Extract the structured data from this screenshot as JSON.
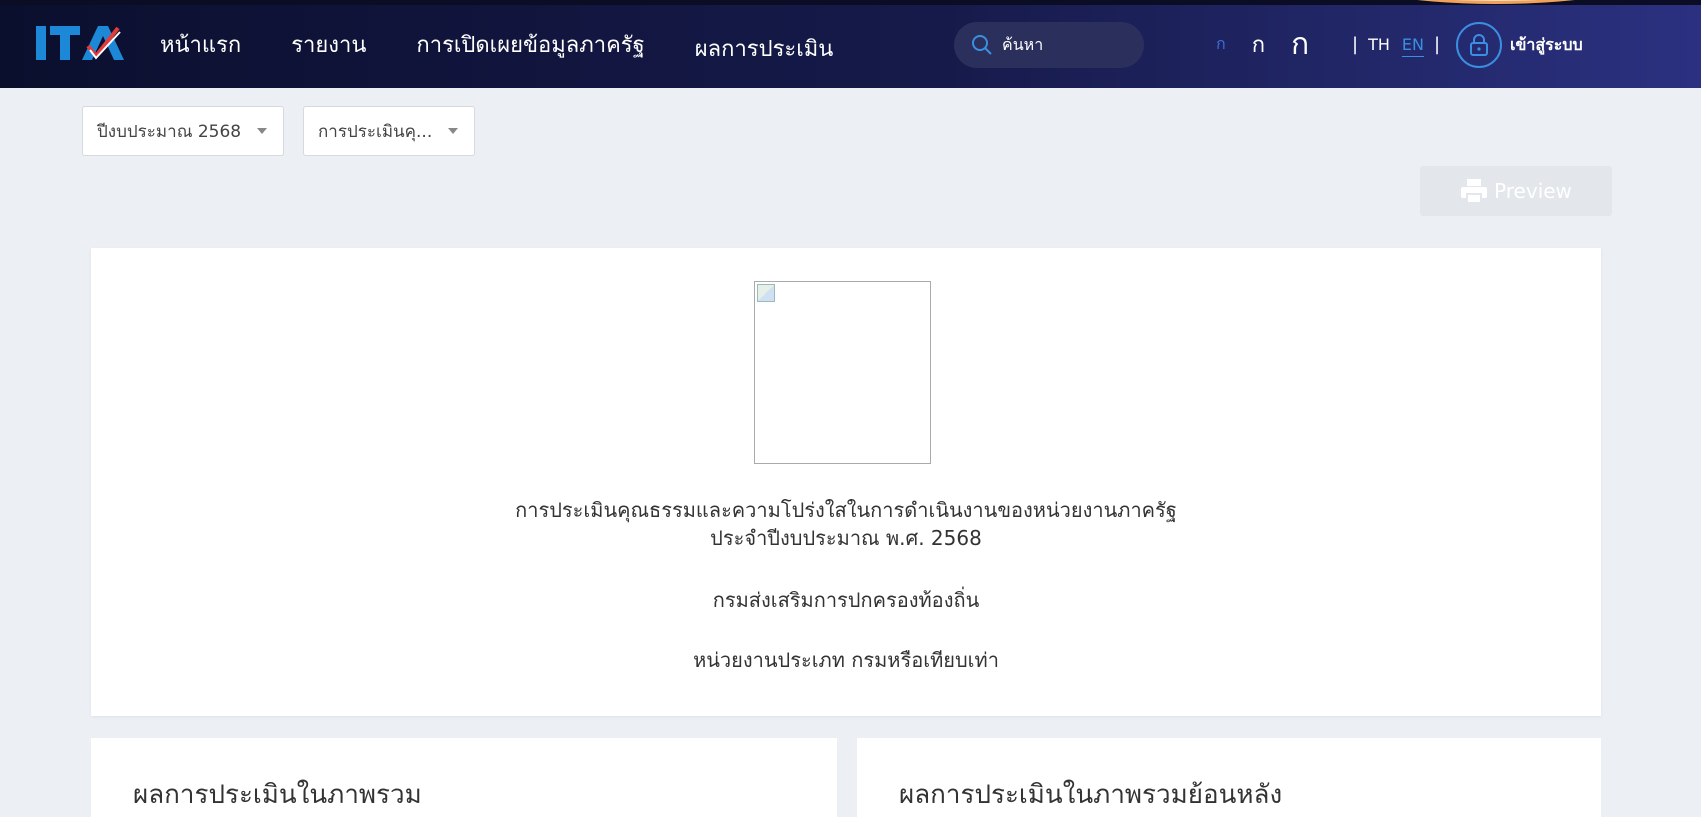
{
  "header": {
    "logo_text": "ITA",
    "nav": [
      {
        "label": "หน้าแรก"
      },
      {
        "label": "รายงาน"
      },
      {
        "label": "การเปิดเผยข้อมูลภาครัฐ"
      },
      {
        "label": "ผลการประเมิน"
      }
    ],
    "search_placeholder": "ค้นหา",
    "font_sizes": [
      "ก",
      "ก",
      "ก"
    ],
    "lang_th": "TH",
    "lang_en": "EN",
    "lang_sep": "|",
    "login_label": "เข้าสู่ระบบ"
  },
  "filters": {
    "year_label": "ปีงบประมาณ 2568",
    "assessment_label": "การประเมินคุ..."
  },
  "preview_label": "Preview",
  "summary": {
    "title_line1": "การประเมินคุณธรรมและความโปร่งใสในการดำเนินงานของหน่วยงานภาครัฐ",
    "title_line2": "ประจำปีงบประมาณ พ.ศ. 2568",
    "agency": "กรมส่งเสริมการปกครองท้องถิ่น",
    "agency_type": "หน่วยงานประเภท กรมหรือเทียบเท่า"
  },
  "panels": {
    "overall": "ผลการประเมินในภาพรวม",
    "historical": "ผลการประเมินในภาพรวมย้อนหลัง"
  },
  "colors": {
    "header_dark": "#0b0f2e",
    "accent_blue": "#3b8fe0",
    "page_bg": "#eceff4"
  }
}
